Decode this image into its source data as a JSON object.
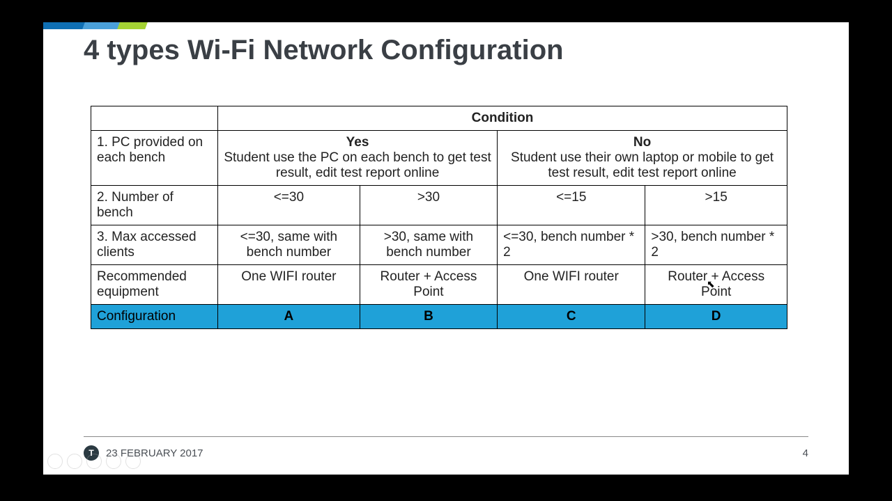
{
  "title": "4 types Wi-Fi Network Configuration",
  "table": {
    "condition_header": "Condition",
    "row1_label": "1. PC provided on each bench",
    "yes_heading": "Yes",
    "yes_desc": "Student use the PC on each bench to get test result, edit test report online",
    "no_heading": "No",
    "no_desc": "Student use their own laptop or mobile to  get test result, edit test report online",
    "row2_label": "2. Number of bench",
    "row2_colA": "<=30",
    "row2_colB": ">30",
    "row2_colC": "<=15",
    "row2_colD": ">15",
    "row3_label": "3. Max accessed clients",
    "row3_colA": "<=30, same with bench number",
    "row3_colB": ">30, same with bench number",
    "row3_colC": "<=30, bench number * 2",
    "row3_colD": ">30, bench number * 2",
    "row4_label": "Recommended equipment",
    "row4_colA": "One WIFI router",
    "row4_colB": "Router + Access Point",
    "row4_colC": "One WIFI router",
    "row4_colD": "Router + Access Point",
    "row5_label": "Configuration",
    "row5_colA": "A",
    "row5_colB": "B",
    "row5_colC": "C",
    "row5_colD": "D"
  },
  "footer": {
    "logo_text": "T",
    "date": "23 FEBRUARY 2017",
    "page": "4"
  }
}
